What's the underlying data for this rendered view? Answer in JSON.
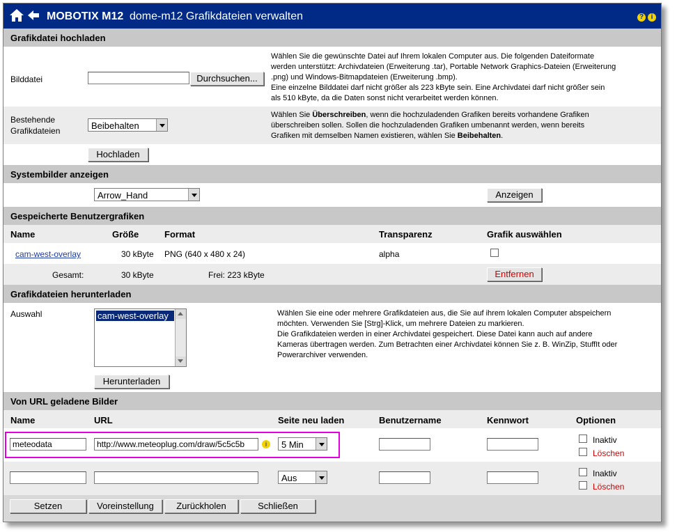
{
  "title": {
    "brand": "MOBOTIX M12",
    "subtitle": "dome-m12 Grafikdateien verwalten",
    "help_q": "?",
    "help_i": "i"
  },
  "upload": {
    "section": "Grafikdatei hochladen",
    "file_label": "Bilddatei",
    "file_value": "",
    "browse": "Durchsuchen...",
    "desc_line1": "Wählen Sie die gewünschte Datei auf Ihrem lokalen Computer aus. Die folgenden Dateiformate",
    "desc_line2": "werden unterstützt: Archivdateien (Erweiterung .tar), Portable Network Graphics-Dateien (Erweiterung",
    "desc_line3": ".png) und Windows-Bitmapdateien (Erweiterung .bmp).",
    "desc_line4": "Eine einzelne Bilddatei darf nicht größer als 223 kByte sein. Eine Archivdatei darf nicht größer sein",
    "desc_line5": "als 510 kByte, da die Daten sonst nicht verarbeitet werden können.",
    "existing_label1": "Bestehende",
    "existing_label2": "Grafikdateien",
    "existing_select": "Beibehalten",
    "existing_desc1_a": "Wählen Sie ",
    "existing_desc1_b": "Überschreiben",
    "existing_desc1_c": ", wenn die hochzuladenden Grafiken bereits vorhandene Grafiken",
    "existing_desc2": "überschreiben sollen. Sollen die hochzuladenden Grafiken umbenannt werden, wenn bereits",
    "existing_desc3_a": "Grafiken mit demselben Namen existieren, wählen Sie ",
    "existing_desc3_b": "Beibehalten",
    "existing_desc3_c": ".",
    "upload_button": "Hochladen"
  },
  "system": {
    "section": "Systembilder anzeigen",
    "select": "Arrow_Hand",
    "show_button": "Anzeigen"
  },
  "stored": {
    "section": "Gespeicherte Benutzergrafiken",
    "headers": {
      "name": "Name",
      "size": "Größe",
      "format": "Format",
      "transparency": "Transparenz",
      "select": "Grafik auswählen"
    },
    "row": {
      "name": "cam-west-overlay",
      "size": "30 kByte",
      "format": "PNG (640 x 480 x 24)",
      "transparency": "alpha"
    },
    "total_label": "Gesamt:",
    "total_size": "30 kByte",
    "free": "Frei: 223 kByte",
    "remove_button": "Entfernen"
  },
  "download": {
    "section": "Grafikdateien herunterladen",
    "label": "Auswahl",
    "list_item": "cam-west-overlay",
    "desc1": "Wählen Sie eine oder mehrere Grafikdateien aus, die Sie auf ihrem lokalen Computer abspeichern",
    "desc2": "möchten. Verwenden Sie [Strg]-Klick, um mehrere Dateien zu markieren.",
    "desc3": "Die Grafikdateien werden in einer Archivdatei gespeichert. Diese Datei kann auch auf andere",
    "desc4": "Kameras übertragen werden. Zum Betrachten einer Archivdatei können Sie z. B. WinZip, StuffIt oder",
    "desc5": "Powerarchiver verwenden.",
    "button": "Herunterladen"
  },
  "url_images": {
    "section": "Von URL geladene Bilder",
    "headers": {
      "name": "Name",
      "url": "URL",
      "reload": "Seite neu laden",
      "user": "Benutzername",
      "password": "Kennwort",
      "options": "Optionen"
    },
    "rows": [
      {
        "name": "meteodata",
        "url": "http://www.meteoplug.com/draw/5c5c5b",
        "reload": "5 Min",
        "user": "",
        "password": "",
        "inactive": "Inaktiv",
        "delete": "Löschen"
      },
      {
        "name": "",
        "url": "",
        "reload": "Aus",
        "user": "",
        "password": "",
        "inactive": "Inaktiv",
        "delete": "Löschen"
      }
    ]
  },
  "footer": {
    "set": "Setzen",
    "default": "Voreinstellung",
    "restore": "Zurückholen",
    "close": "Schließen"
  },
  "colors": {
    "titlebar": "#002a85",
    "section": "#c8c8c8",
    "highlight": "#e000e0",
    "link": "#1a3aa6",
    "danger": "#d20000"
  }
}
